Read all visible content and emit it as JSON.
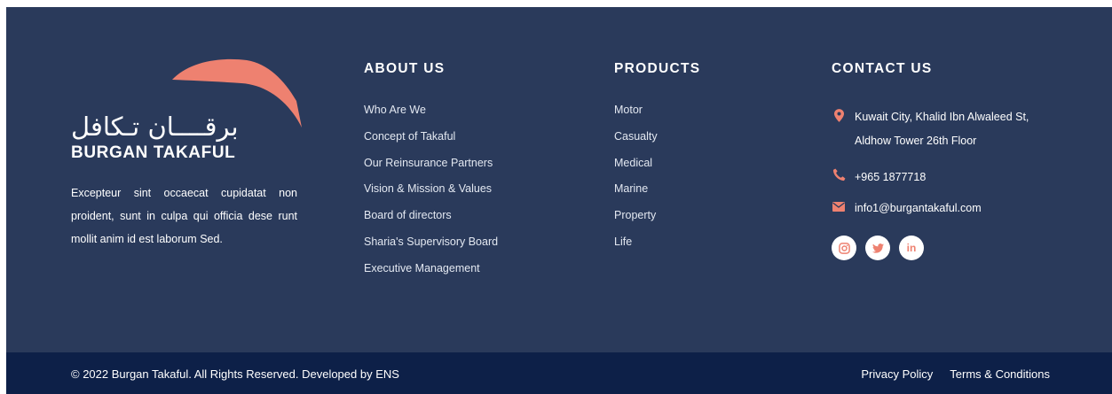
{
  "brand": {
    "logo_arabic": "برقــــان تـكافل",
    "logo_latin": "BURGAN TAKAFUL",
    "description": "Excepteur sint occaecat cupidatat non proident, sunt in culpa qui officia dese runt mollit anim id est laborum Sed.",
    "accent_color": "#ee8170"
  },
  "about": {
    "heading": "ABOUT US",
    "links": [
      "Who Are We",
      "Concept of Takaful",
      "Our Reinsurance Partners",
      "Vision & Mission & Values",
      "Board of directors",
      "Sharia's Supervisory Board",
      "Executive Management"
    ]
  },
  "products": {
    "heading": "PRODUCTS",
    "links": [
      "Motor",
      "Casualty",
      "Medical",
      "Marine",
      "Property",
      "Life"
    ]
  },
  "contact": {
    "heading": "CONTACT US",
    "address": "Kuwait City, Khalid Ibn Alwaleed St, Aldhow Tower 26th Floor",
    "phone": "+965 1877718",
    "email": "info1@burgantakaful.com",
    "icons": [
      "map-pin-icon",
      "phone-icon",
      "envelope-icon"
    ],
    "socials": [
      "instagram-icon",
      "twitter-icon",
      "linkedin-icon"
    ]
  },
  "footer_bar": {
    "copyright": "© 2022 Burgan Takaful. All Rights Reserved. Developed by ENS",
    "privacy": "Privacy Policy",
    "terms": "Terms & Conditions"
  },
  "colors": {
    "footer_bg": "#2a3a5b",
    "bottom_bar_bg": "#0d2048",
    "icon_accent": "#ee8170"
  }
}
